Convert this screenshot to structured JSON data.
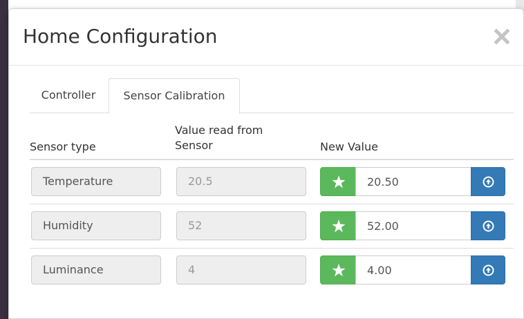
{
  "modal": {
    "title": "Home Configuration",
    "close_icon": "close-icon"
  },
  "tabs": [
    {
      "label": "Controller",
      "active": false
    },
    {
      "label": "Sensor Calibration",
      "active": true
    }
  ],
  "table": {
    "headers": {
      "sensor_type": "Sensor type",
      "value_read": "Value read from Sensor",
      "new_value": "New Value"
    },
    "rows": [
      {
        "sensor_type": "Temperature",
        "value_read": "20.5",
        "new_value": "20.50"
      },
      {
        "sensor_type": "Humidity",
        "value_read": "52",
        "new_value": "52.00"
      },
      {
        "sensor_type": "Luminance",
        "value_read": "4",
        "new_value": "4.00"
      }
    ]
  },
  "icons": {
    "star": "star-icon",
    "upload": "circle-arrow-up-icon"
  },
  "colors": {
    "success": "#5cb85c",
    "primary": "#337ab7",
    "text": "#333333",
    "readonly_bg": "#eeeeee"
  }
}
